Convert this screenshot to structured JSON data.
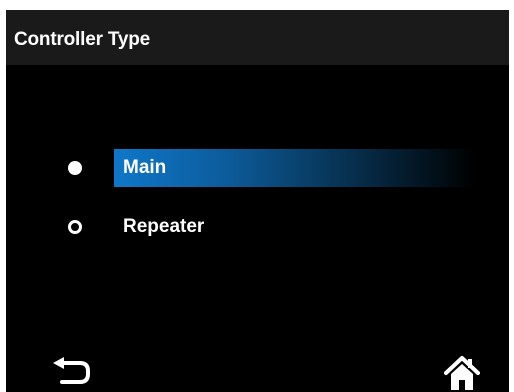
{
  "screen": {
    "title": "Controller Type"
  },
  "options": [
    {
      "label": "Main",
      "selected": true
    },
    {
      "label": "Repeater",
      "selected": false
    }
  ],
  "footer": {
    "back_icon": "back-arrow-icon",
    "home_icon": "home-icon"
  },
  "colors": {
    "background": "#000000",
    "header": "#1a1a1a",
    "accent": "#0f77c8",
    "text": "#ffffff"
  }
}
